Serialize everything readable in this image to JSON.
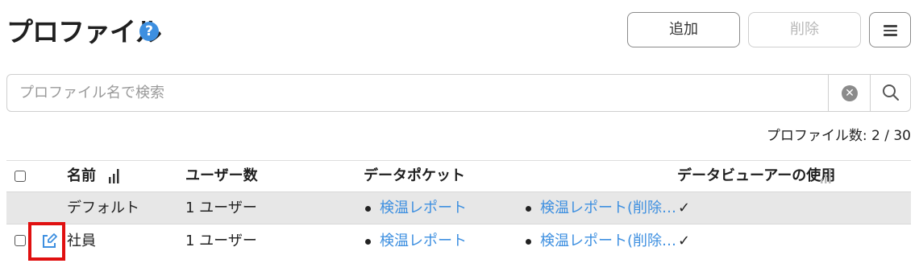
{
  "header": {
    "title": "プロファイル",
    "help_glyph": "?",
    "add_label": "追加",
    "delete_label": "削除"
  },
  "search": {
    "placeholder": "プロファイル名で検索",
    "value": ""
  },
  "count_label": "プロファイル数: 2 / 30",
  "table": {
    "columns": [
      "名前",
      "ユーザー数",
      "データポケット",
      "データビューアーの使用"
    ],
    "rows": [
      {
        "name": "デフォルト",
        "users": "1 ユーザー",
        "pocket1": "検温レポート",
        "pocket2": "検温レポート(削除…",
        "viewer": "✓",
        "highlighted": true
      },
      {
        "name": "社員",
        "users": "1 ユーザー",
        "pocket1": "検温レポート",
        "pocket2": "検温レポート(削除…",
        "viewer": "✓",
        "highlighted": false
      }
    ]
  },
  "icons": {
    "help": "help-icon",
    "menu": "hamburger-icon",
    "clear": "clear-icon",
    "search": "search-icon",
    "sort": "sort-bars-icon",
    "edit": "edit-icon",
    "check": "checkmark-icon"
  },
  "colors": {
    "accent": "#3d8fe0",
    "highlight_row": "#e7e7e7",
    "annotation_frame": "#e01010"
  }
}
